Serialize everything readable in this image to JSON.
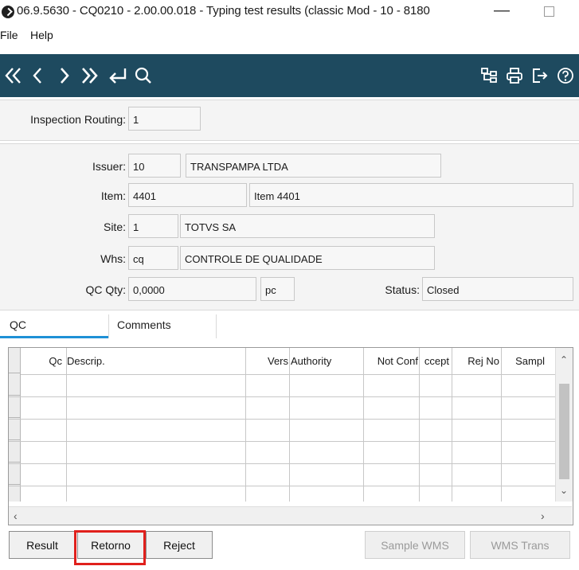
{
  "window": {
    "title": "06.9.5630 - CQ0210 - 2.00.00.018 - Typing test results (classic Mod - 10 - 8180",
    "minimize_glyph": "—"
  },
  "menu": [
    "File",
    "Help"
  ],
  "toolbar": {
    "left_icons": [
      "first-record-icon",
      "previous-record-icon",
      "next-record-icon",
      "last-record-icon",
      "goto-return-icon",
      "search-icon"
    ],
    "right_icons": [
      "tree-view-icon",
      "print-icon",
      "exit-icon",
      "help-icon"
    ],
    "color": "#1e4a5f"
  },
  "routing": {
    "label": "Inspection Routing:",
    "value": "1"
  },
  "details": {
    "issuer_label": "Issuer:",
    "issuer_code": "10",
    "issuer_name": "TRANSPAMPA LTDA",
    "item_label": "Item:",
    "item_code": "4401",
    "item_desc": "Item 4401",
    "site_label": "Site:",
    "site_code": "1",
    "site_name": "TOTVS SA",
    "whs_label": "Whs:",
    "whs_code": "cq",
    "whs_name": "CONTROLE DE QUALIDADE",
    "qcqty_label": "QC Qty:",
    "qcqty_value": "0,0000",
    "unit_value": "pc",
    "status_label": "Status:",
    "status_value": "Closed"
  },
  "tabs": [
    {
      "label": "QC",
      "active": true
    },
    {
      "label": "Comments",
      "active": false
    }
  ],
  "grid": {
    "columns": [
      "Qc",
      "Descrip.",
      "Vers",
      "Authority",
      "Not Conf",
      "ccept",
      "Rej No",
      "Sampl"
    ],
    "row_count": 6,
    "rows": []
  },
  "buttons": {
    "result": "Result",
    "retorno": "Retorno",
    "reject": "Reject",
    "sample_wms": "Sample WMS",
    "wms_trans": "WMS Trans"
  },
  "colors": {
    "accent": "#1e90d6",
    "highlight": "#e0201c"
  }
}
